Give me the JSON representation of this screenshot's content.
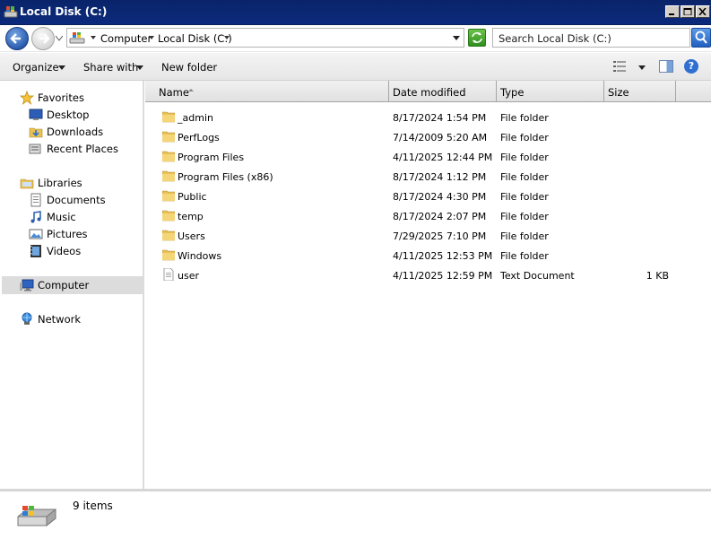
{
  "window": {
    "title": "Local Disk (C:)"
  },
  "address": {
    "crumbs": [
      "Computer",
      "Local Disk (C:)"
    ]
  },
  "search": {
    "placeholder": "Search Local Disk (C:)"
  },
  "toolbar": {
    "organize": "Organize",
    "share_with": "Share with",
    "new_folder": "New folder"
  },
  "nav": {
    "favorites": "Favorites",
    "desktop": "Desktop",
    "downloads": "Downloads",
    "recent_places": "Recent Places",
    "libraries": "Libraries",
    "documents": "Documents",
    "music": "Music",
    "pictures": "Pictures",
    "videos": "Videos",
    "computer": "Computer",
    "network": "Network"
  },
  "columns": {
    "name": "Name",
    "date_modified": "Date modified",
    "type": "Type",
    "size": "Size"
  },
  "files": [
    {
      "name": "_admin",
      "date": "8/17/2024 1:54 PM",
      "type": "File folder",
      "size": "",
      "icon": "folder-icon"
    },
    {
      "name": "PerfLogs",
      "date": "7/14/2009 5:20 AM",
      "type": "File folder",
      "size": "",
      "icon": "folder-icon"
    },
    {
      "name": "Program Files",
      "date": "4/11/2025 12:44 PM",
      "type": "File folder",
      "size": "",
      "icon": "folder-icon"
    },
    {
      "name": "Program Files (x86)",
      "date": "8/17/2024 1:12 PM",
      "type": "File folder",
      "size": "",
      "icon": "folder-icon"
    },
    {
      "name": "Public",
      "date": "8/17/2024 4:30 PM",
      "type": "File folder",
      "size": "",
      "icon": "folder-icon"
    },
    {
      "name": "temp",
      "date": "8/17/2024 2:07 PM",
      "type": "File folder",
      "size": "",
      "icon": "folder-icon"
    },
    {
      "name": "Users",
      "date": "7/29/2025 7:10 PM",
      "type": "File folder",
      "size": "",
      "icon": "folder-icon"
    },
    {
      "name": "Windows",
      "date": "4/11/2025 12:53 PM",
      "type": "File folder",
      "size": "",
      "icon": "folder-icon"
    },
    {
      "name": "user",
      "date": "4/11/2025 12:59 PM",
      "type": "Text Document",
      "size": "1 KB",
      "icon": "text-document-icon"
    }
  ],
  "status": {
    "item_count": "9 items"
  }
}
